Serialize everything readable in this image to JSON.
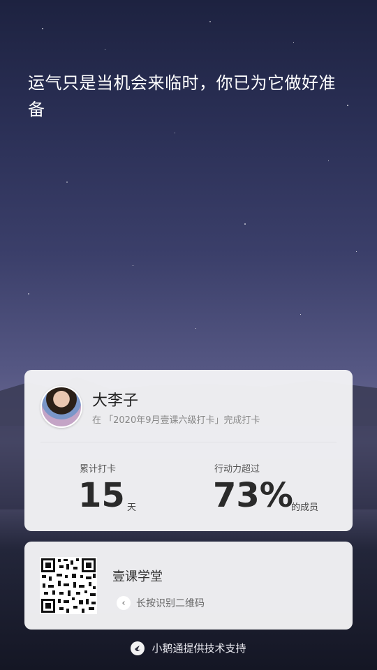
{
  "quote": "运气只是当机会来临时，你已为它做好准备",
  "profile": {
    "name": "大李子",
    "subline": "在 「2020年9月壹课六级打卡」完成打卡",
    "checkin_label": "累计打卡",
    "checkin_value": "15",
    "checkin_unit": "天",
    "action_label": "行动力超过",
    "action_value": "73%",
    "action_unit": "的成员"
  },
  "qr_card": {
    "title": "壹课学堂",
    "hint": "长按识别二维码"
  },
  "footer": {
    "text": "小鹅通提供技术支持"
  }
}
